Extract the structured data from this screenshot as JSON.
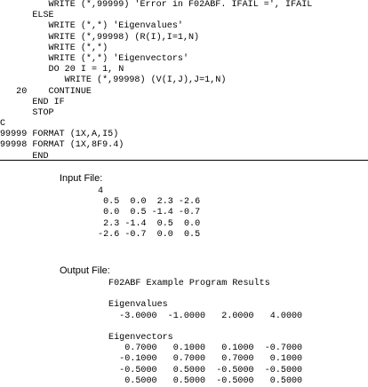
{
  "code": {
    "lines": [
      "         WRITE (*,99999) 'Error in F02ABF. IFAIL =', IFAIL",
      "      ELSE",
      "         WRITE (*,*) 'Eigenvalues'",
      "         WRITE (*,99998) (R(I),I=1,N)",
      "         WRITE (*,*)",
      "         WRITE (*,*) 'Eigenvectors'",
      "         DO 20 I = 1, N",
      "            WRITE (*,99998) (V(I,J),J=1,N)",
      "   20    CONTINUE",
      "      END IF",
      "      STOP",
      "C",
      "99999 FORMAT (1X,A,I5)",
      "99998 FORMAT (1X,8F9.4)",
      "      END"
    ]
  },
  "input_file": {
    "label": "Input File:",
    "lines": [
      " 4",
      "  0.5  0.0  2.3 -2.6",
      "  0.0  0.5 -1.4 -0.7",
      "  2.3 -1.4  0.5  0.0",
      " -2.6 -0.7  0.0  0.5"
    ]
  },
  "output_file": {
    "label": "Output File:",
    "lines": [
      " F02ABF Example Program Results",
      "",
      " Eigenvalues",
      "   -3.0000  -1.0000   2.0000   4.0000",
      "",
      " Eigenvectors",
      "    0.7000   0.1000   0.1000  -0.7000",
      "   -0.1000   0.7000   0.7000   0.1000",
      "   -0.5000   0.5000  -0.5000  -0.5000",
      "    0.5000   0.5000  -0.5000   0.5000"
    ]
  }
}
